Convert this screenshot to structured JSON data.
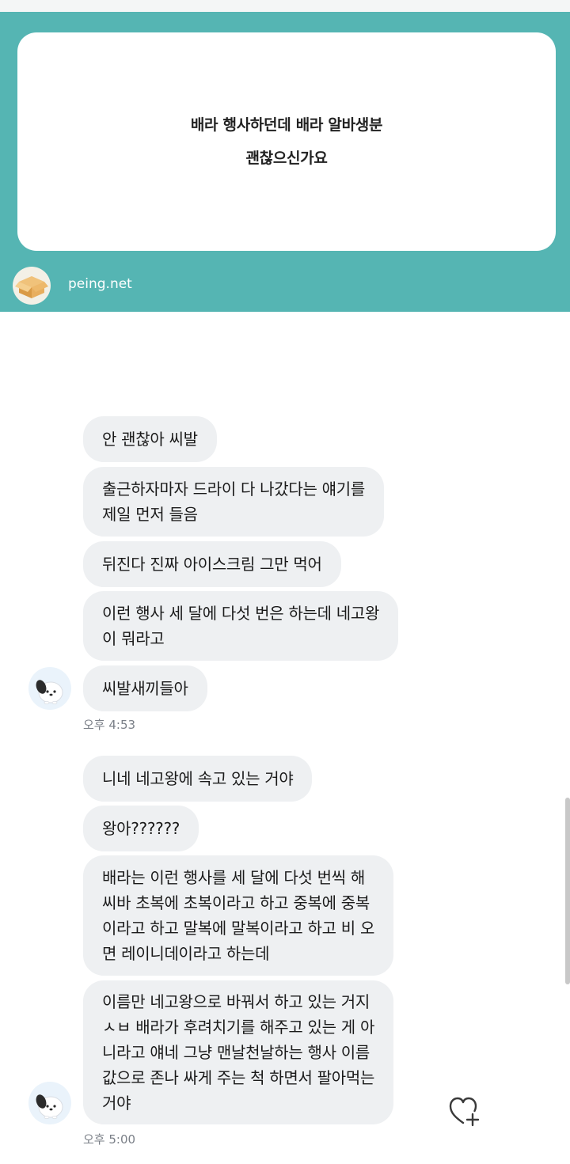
{
  "peing_card": {
    "question_lines": [
      "배라 행사하던데 배라 알바생분",
      "괜찮으신가요"
    ],
    "domain": "peing.net",
    "logo_icon": "cardboard-box-icon",
    "accent_color": "#55b5b3"
  },
  "chat": {
    "groups": [
      {
        "messages": [
          {
            "lines": [
              "안 괜찮아 씨발"
            ]
          },
          {
            "lines": [
              "출근하자마자 드라이 다 나갔다는 얘기를",
              "제일 먼저 들음"
            ]
          },
          {
            "lines": [
              "뒤진다 진짜 아이스크림 그만 먹어"
            ]
          },
          {
            "lines": [
              "이런 행사 세 달에 다섯 번은 하는데 네고왕",
              "이 뭐라고"
            ]
          },
          {
            "lines": [
              "씨발새끼들아"
            ]
          }
        ],
        "timestamp": "오후 4:53",
        "avatar_icon": "pochacco-avatar-icon"
      },
      {
        "messages": [
          {
            "lines": [
              "니네 네고왕에 속고 있는 거야"
            ]
          },
          {
            "lines": [
              "왕아??????"
            ]
          },
          {
            "lines": [
              "배라는 이런 행사를 세 달에 다섯 번씩 해",
              "씨바 초복에 초복이라고 하고 중복에 중복",
              "이라고 하고 말복에 말복이라고 하고 비 오",
              "면 레이니데이라고 하는데"
            ]
          },
          {
            "lines": [
              "이름만 네고왕으로 바꿔서 하고 있는 거지",
              "ㅅㅂ 배라가 후려치기를 해주고 있는 게 아",
              "니라고 얘네 그냥 맨날천날하는 행사 이름",
              "값으로 존나 싸게 주는 척 하면서 팔아먹는",
              "거야"
            ]
          }
        ],
        "timestamp": "오후 5:00",
        "avatar_icon": "pochacco-avatar-icon",
        "reaction_icon": "heart-plus-icon"
      }
    ],
    "bubble_color": "#eef0f2"
  }
}
